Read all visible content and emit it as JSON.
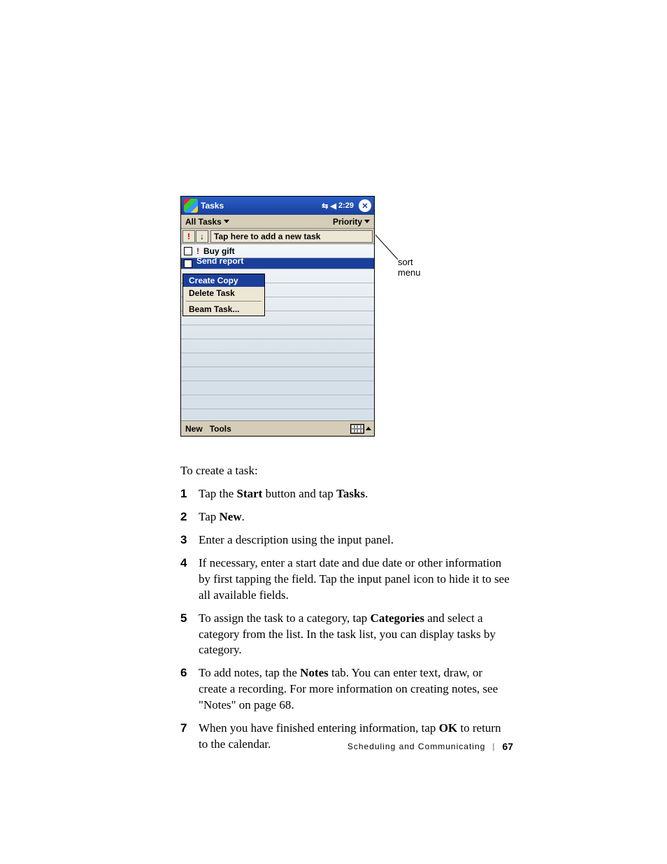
{
  "pda": {
    "title": "Tasks",
    "time": "2:29",
    "filter_left": "All Tasks",
    "filter_right": "Priority",
    "add_task_placeholder": "Tap here to add a new task",
    "priority_mark": "!",
    "arrow_mark": "↓",
    "tasks": [
      {
        "label": "Buy gift",
        "priority": true
      },
      {
        "label": "Send report",
        "priority": false
      }
    ],
    "context_menu": {
      "create_copy": "Create Copy",
      "delete_task": "Delete Task",
      "beam_task": "Beam Task..."
    },
    "bottom_new": "New",
    "bottom_tools": "Tools"
  },
  "callout": "sort menu",
  "intro": "To create a task:",
  "steps": [
    {
      "n": "1",
      "pre": "Tap the ",
      "b1": "Start",
      "mid": " button and tap ",
      "b2": "Tasks",
      "post": "."
    },
    {
      "n": "2",
      "pre": "Tap ",
      "b1": "New",
      "mid": "",
      "b2": "",
      "post": "."
    },
    {
      "n": "3",
      "pre": "Enter a description using the input panel.",
      "b1": "",
      "mid": "",
      "b2": "",
      "post": ""
    },
    {
      "n": "4",
      "pre": "If necessary, enter a start date and due date or other information by first tapping the field. Tap the input panel icon to hide it to see all available fields.",
      "b1": "",
      "mid": "",
      "b2": "",
      "post": ""
    },
    {
      "n": "5",
      "pre": "To assign the task to a category, tap ",
      "b1": "Categories",
      "mid": " and select a category from the list. In the task list, you can display tasks by category.",
      "b2": "",
      "post": ""
    },
    {
      "n": "6",
      "pre": "To add notes, tap the ",
      "b1": "Notes",
      "mid": " tab. You can enter text, draw, or create a recording. For more information on creating notes, see \"Notes\" on page 68.",
      "b2": "",
      "post": ""
    },
    {
      "n": "7",
      "pre": "When you have finished entering information, tap ",
      "b1": "OK",
      "mid": " to return to the calendar.",
      "b2": "",
      "post": ""
    }
  ],
  "footer": {
    "section": "Scheduling and Communicating",
    "page": "67"
  }
}
